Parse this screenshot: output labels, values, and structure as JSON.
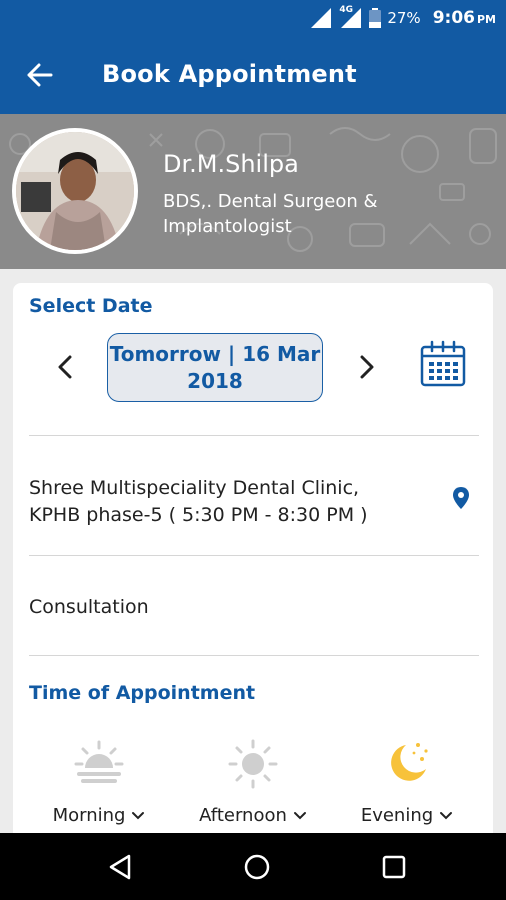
{
  "status_bar": {
    "network": "4G",
    "battery": "27%",
    "time": "9:06",
    "ampm": "PM"
  },
  "app_bar": {
    "title": "Book Appointment"
  },
  "doctor": {
    "name": "Dr.M.Shilpa",
    "qualification": "BDS,. Dental Surgeon & Implantologist"
  },
  "select_date": {
    "heading": "Select Date",
    "date_line1": "Tomorrow | 16 Mar",
    "date_line2": "2018"
  },
  "clinic": {
    "line1": "Shree Multispeciality Dental Clinic,",
    "line2": "KPHB phase-5 ( 5:30 PM - 8:30 PM )"
  },
  "consultation": {
    "label": "Consultation"
  },
  "time_of_appointment": {
    "heading": "Time of Appointment",
    "slots": [
      {
        "label": "Morning",
        "icon": "sunrise-icon",
        "active": false
      },
      {
        "label": "Afternoon",
        "icon": "sun-icon",
        "active": false
      },
      {
        "label": "Evening",
        "icon": "moon-icon",
        "active": true
      }
    ]
  },
  "colors": {
    "primary": "#125aa3",
    "active_slot": "#f7c23a",
    "inactive_slot": "#cfcfcf"
  }
}
